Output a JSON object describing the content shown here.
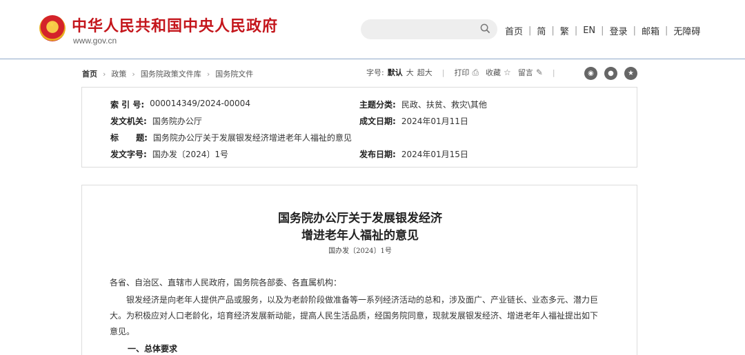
{
  "header": {
    "site_title": "中华人民共和国中央人民政府",
    "site_url": "www.gov.cn",
    "search_placeholder": "",
    "nav": [
      "首页",
      "简",
      "繁",
      "EN",
      "登录",
      "邮箱",
      "无障碍"
    ]
  },
  "breadcrumb": {
    "items": [
      "首页",
      "政策",
      "国务院政策文件库",
      "国务院文件"
    ]
  },
  "tools": {
    "font_size_label": "字号:",
    "font_default": "默认",
    "font_large": "大",
    "font_xlarge": "超大",
    "print_label": "打印",
    "favorite_label": "收藏",
    "comment_label": "留言"
  },
  "info": {
    "index_key": "索 引 号:",
    "index_val": "000014349/2024-00004",
    "topic_key": "主题分类:",
    "topic_val": "民政、扶贫、救灾\\其他",
    "issuer_key": "发文机关:",
    "issuer_val": "国务院办公厅",
    "created_key": "成文日期:",
    "created_val": "2024年01月11日",
    "title_key": "标      题:",
    "title_val": "国务院办公厅关于发展银发经济增进老年人福祉的意见",
    "docno_key": "发文字号:",
    "docno_val": "国办发〔2024〕1号",
    "published_key": "发布日期:",
    "published_val": "2024年01月15日"
  },
  "article": {
    "title_line1": "国务院办公厅关于发展银发经济",
    "title_line2": "增进老年人福祉的意见",
    "doc_number": "国办发〔2024〕1号",
    "salutation": "各省、自治区、直辖市人民政府，国务院各部委、各直属机构：",
    "para1_line1": "银发经济是向老年人提供产品或服务，以及为老龄阶段做准备等一系列经济活动的总和，涉及面广、产业链长、业态多元、潜力巨",
    "para1_line2": "大。为积极应对人口老龄化，培育经济发展新动能，提高人民生活品质，经国务院同意，现就发展银发经济、增进老年人福祉提出如下",
    "para1_line3": "意见。",
    "section1": "一、总体要求"
  },
  "colors": {
    "brand_red": "#c4161c",
    "header_rule": "#8fa9c9",
    "box_border": "#dcdcdc"
  }
}
